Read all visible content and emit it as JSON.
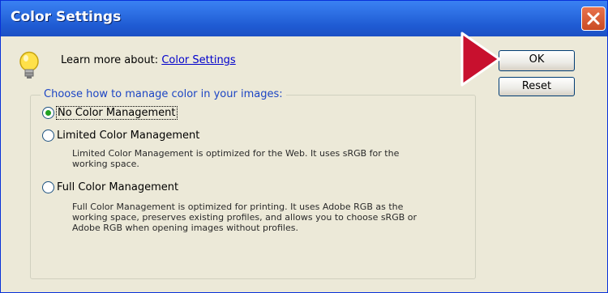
{
  "window": {
    "title": "Color Settings"
  },
  "learn": {
    "prefix": "Learn more about:",
    "link": "Color Settings"
  },
  "buttons": {
    "ok": "OK",
    "reset": "Reset"
  },
  "group": {
    "legend": "Choose how to manage color in your images:",
    "options": [
      {
        "label": "No Color Management",
        "selected": true,
        "description": ""
      },
      {
        "label": "Limited Color Management",
        "selected": false,
        "description_lines": [
          "Limited Color Management is optimized for the Web. It uses sRGB for the",
          "working space."
        ]
      },
      {
        "label": "Full Color Management",
        "selected": false,
        "description_lines": [
          "Full Color Management is optimized for printing. It uses Adobe RGB as the",
          "working space, preserves existing profiles, and allows you to choose sRGB or",
          "Adobe RGB when opening images without profiles."
        ]
      }
    ]
  },
  "colors": {
    "titlebar": "#2d6fe3",
    "arrow": "#c8102e",
    "legend": "#1c45c4"
  }
}
